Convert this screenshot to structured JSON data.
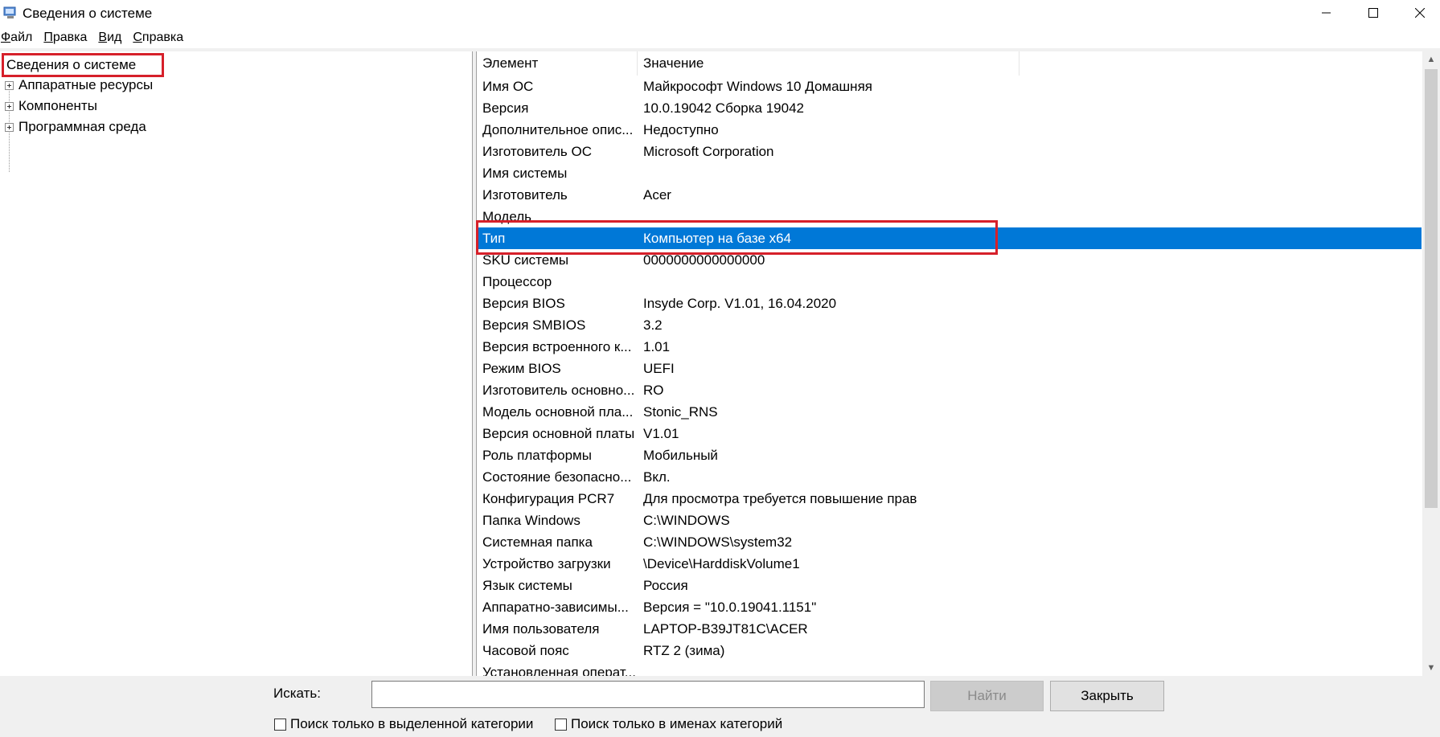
{
  "window": {
    "title": "Сведения о системе",
    "minimize_icon": "minimize-icon",
    "maximize_icon": "maximize-icon",
    "close_icon": "close-icon"
  },
  "menu": [
    {
      "label": "Файл",
      "accel": "Ф",
      "rest": "айл"
    },
    {
      "label": "Правка",
      "accel": "П",
      "rest": "равка"
    },
    {
      "label": "Вид",
      "accel": "В",
      "rest": "ид"
    },
    {
      "label": "Справка",
      "accel": "С",
      "rest": "правка"
    }
  ],
  "tree": {
    "root": "Сведения о системе",
    "items": [
      "Аппаратные ресурсы",
      "Компоненты",
      "Программная среда"
    ]
  },
  "list": {
    "columns": [
      "Элемент",
      "Значение"
    ],
    "rows": [
      [
        "Имя ОС",
        "Майкрософт Windows 10 Домашняя"
      ],
      [
        "Версия",
        "10.0.19042 Сборка 19042"
      ],
      [
        "Дополнительное опис...",
        "Недоступно"
      ],
      [
        "Изготовитель ОС",
        "Microsoft Corporation"
      ],
      [
        "Имя системы",
        ""
      ],
      [
        "Изготовитель",
        "Acer"
      ],
      [
        "Модель",
        ""
      ],
      [
        "Тип",
        "Компьютер на базе x64"
      ],
      [
        "SKU системы",
        "0000000000000000"
      ],
      [
        "Процессор",
        ""
      ],
      [
        "Версия BIOS",
        "Insyde Corp. V1.01, 16.04.2020"
      ],
      [
        "Версия SMBIOS",
        "3.2"
      ],
      [
        "Версия встроенного к...",
        "1.01"
      ],
      [
        "Режим BIOS",
        "UEFI"
      ],
      [
        "Изготовитель основно...",
        "RO"
      ],
      [
        "Модель основной пла...",
        "Stonic_RNS"
      ],
      [
        "Версия основной платы",
        "V1.01"
      ],
      [
        "Роль платформы",
        "Мобильный"
      ],
      [
        "Состояние безопасно...",
        "Вкл."
      ],
      [
        "Конфигурация PCR7",
        "Для просмотра требуется повышение прав"
      ],
      [
        "Папка Windows",
        "C:\\WINDOWS"
      ],
      [
        "Системная папка",
        "C:\\WINDOWS\\system32"
      ],
      [
        "Устройство загрузки",
        "\\Device\\HarddiskVolume1"
      ],
      [
        "Язык системы",
        "Россия"
      ],
      [
        "Аппаратно-зависимы...",
        "Версия = \"10.0.19041.1151\""
      ],
      [
        "Имя пользователя",
        "LAPTOP-B39JT81C\\ACER"
      ],
      [
        "Часовой пояс",
        "RTZ 2 (зима)"
      ],
      [
        "Установленная операт...",
        ""
      ]
    ],
    "selected_row": 7
  },
  "search": {
    "label": "Искать:",
    "value": "",
    "find_button": "Найти",
    "close_button": "Закрыть",
    "check_selected_category": "Поиск только в выделенной категории",
    "check_category_names": "Поиск только в именах категорий"
  },
  "colors": {
    "selection": "#0078d7",
    "highlight_box": "#d6202a"
  }
}
